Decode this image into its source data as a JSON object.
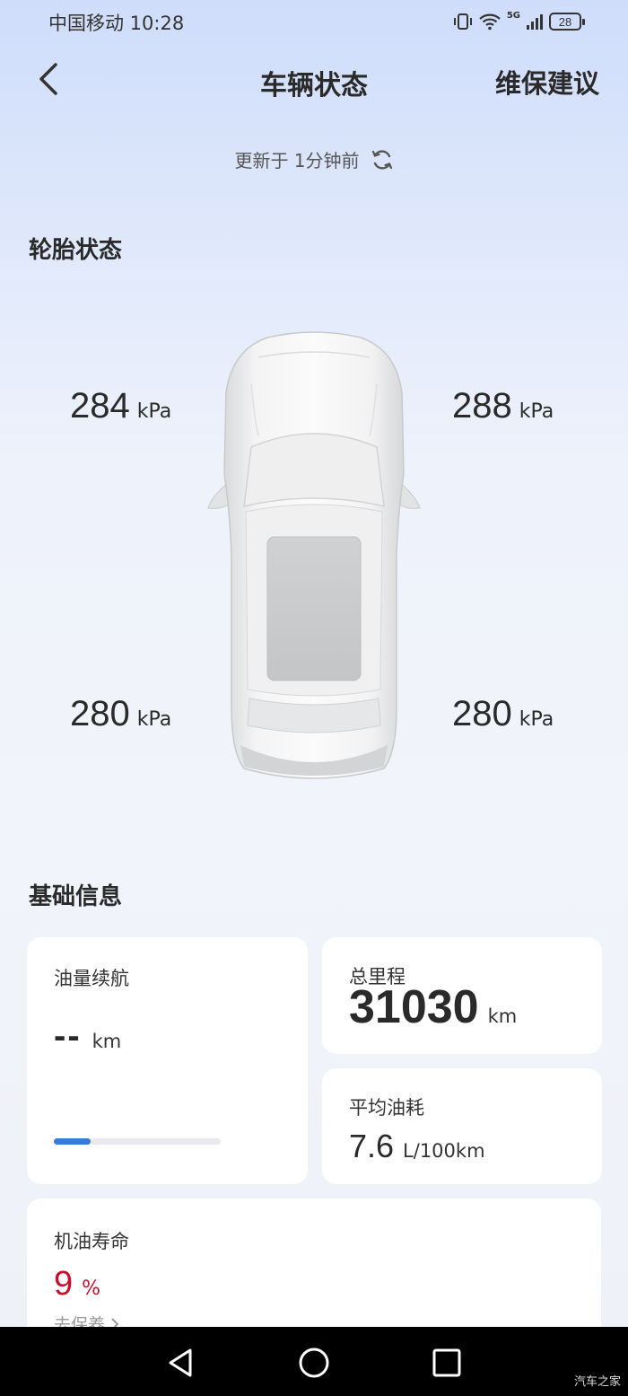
{
  "status_bar": {
    "carrier_time": "中国移动 10:28",
    "network": "5G",
    "battery": "28"
  },
  "header": {
    "title": "车辆状态",
    "right_action": "维保建议",
    "back_icon": "chevron-left-icon"
  },
  "update": {
    "text": "更新于 1分钟前",
    "icon": "refresh-icon"
  },
  "tire_section": {
    "title": "轮胎状态",
    "unit": "kPa",
    "front_left": "284",
    "front_right": "288",
    "rear_left": "280",
    "rear_right": "280"
  },
  "basic_section": {
    "title": "基础信息",
    "fuel_range": {
      "label": "油量续航",
      "value": "--",
      "unit": "km",
      "progress": 0.22,
      "bar_color": "#3a7ad8"
    },
    "odometer": {
      "label": "总里程",
      "value": "31030",
      "unit": "km"
    },
    "avg_fuel": {
      "label": "平均油耗",
      "value": "7.6",
      "unit": "L/100km"
    },
    "oil_life": {
      "label": "机油寿命",
      "value": "9",
      "unit": "%",
      "value_color": "#c8102e",
      "link": "去保养"
    }
  },
  "watermark": "汽车之家"
}
